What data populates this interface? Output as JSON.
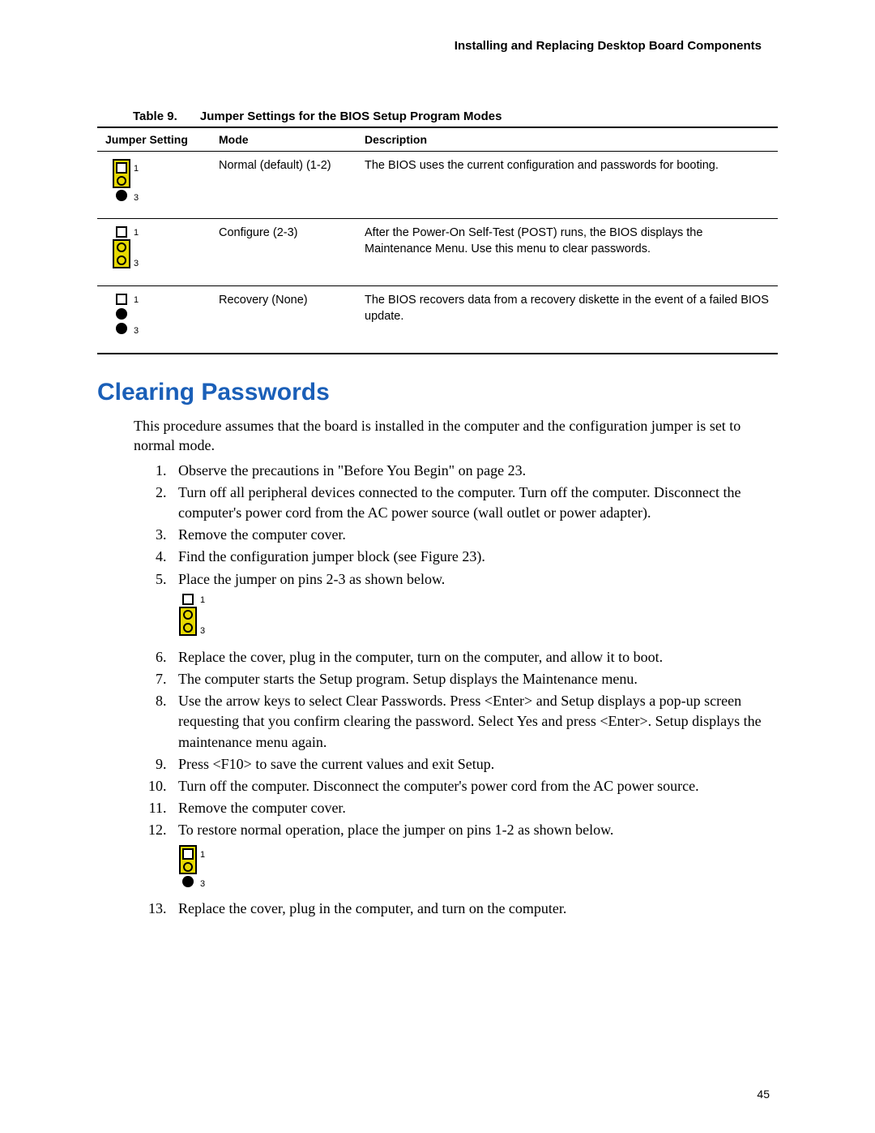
{
  "header": "Installing and Replacing Desktop Board Components",
  "table": {
    "caption_label": "Table 9.",
    "caption_title": "Jumper Settings for the BIOS Setup Program Modes",
    "headers": [
      "Jumper Setting",
      "Mode",
      "Description"
    ],
    "rows": [
      {
        "mode": "Normal (default) (1-2)",
        "desc": "The BIOS uses the current configuration and passwords for booting."
      },
      {
        "mode": "Configure (2-3)",
        "desc": "After the Power-On Self-Test (POST) runs, the BIOS displays the Maintenance Menu.  Use this menu to clear passwords."
      },
      {
        "mode": "Recovery (None)",
        "desc": "The BIOS recovers data from a recovery diskette in the event of a failed BIOS update."
      }
    ]
  },
  "section_title": "Clearing Passwords",
  "intro": "This procedure assumes that the board is installed in the computer and the configuration jumper is set to normal mode.",
  "steps": {
    "s1": "Observe the precautions in \"Before You Begin\" on page 23.",
    "s2": "Turn off all peripheral devices connected to the computer.  Turn off the computer.  Disconnect the computer's power cord from the AC power source (wall outlet or power adapter).",
    "s3": "Remove the computer cover.",
    "s4": "Find the configuration jumper block (see Figure 23).",
    "s5": "Place the jumper on pins 2-3 as shown below.",
    "s6": "Replace the cover, plug in the computer, turn on the computer, and allow it to boot.",
    "s7": "The computer starts the Setup program.  Setup displays the Maintenance menu.",
    "s8": "Use the arrow keys to select Clear Passwords.  Press <Enter> and Setup displays a pop-up screen requesting that you confirm clearing the password.  Select Yes and press <Enter>.  Setup displays the maintenance menu again.",
    "s9": "Press <F10> to save the current values and exit Setup.",
    "s10": "Turn off the computer.  Disconnect the computer's power cord from the AC power source.",
    "s11": "Remove the computer cover.",
    "s12": "To restore normal operation, place the jumper on pins 1-2 as shown below.",
    "s13": "Replace the cover, plug in the computer, and turn on the computer."
  },
  "page_number": "45"
}
